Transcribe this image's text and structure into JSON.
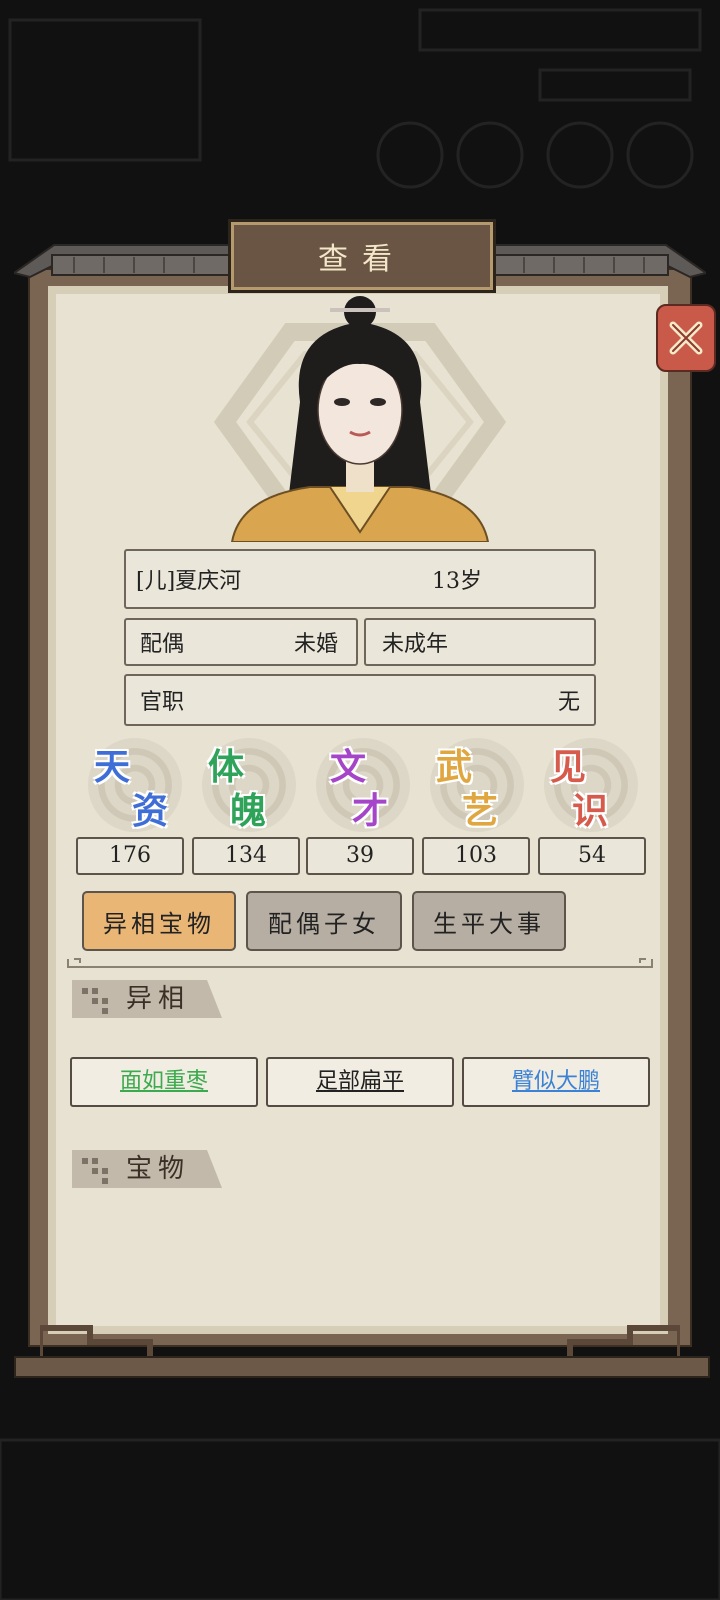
{
  "dialog": {
    "title": "查看"
  },
  "person": {
    "name": "[儿]夏庆河",
    "age": "13岁",
    "spouse_label": "配偶",
    "spouse_value": "未婚",
    "maturity": "未成年",
    "office_label": "官职",
    "office_value": "无"
  },
  "stats": [
    {
      "char1": "天",
      "char2": "资",
      "value": "176",
      "color": "#3f6fd6"
    },
    {
      "char1": "体",
      "char2": "魄",
      "value": "134",
      "color": "#2fa35a"
    },
    {
      "char1": "文",
      "char2": "才",
      "value": "39",
      "color": "#a546c9"
    },
    {
      "char1": "武",
      "char2": "艺",
      "value": "103",
      "color": "#e0a640"
    },
    {
      "char1": "见",
      "char2": "识",
      "value": "54",
      "color": "#d75b4c"
    }
  ],
  "tabs": [
    {
      "label": "异相宝物",
      "active": true
    },
    {
      "label": "配偶子女",
      "active": false
    },
    {
      "label": "生平大事",
      "active": false
    }
  ],
  "sections": {
    "traits_title": "异相",
    "treasures_title": "宝物"
  },
  "traits": [
    {
      "label": "面如重枣",
      "color": "#3caa4e"
    },
    {
      "label": "足部扁平",
      "color": "#222222"
    },
    {
      "label": "臂似大鹏",
      "color": "#3b82d6"
    }
  ],
  "icons": [
    "close-icon"
  ]
}
